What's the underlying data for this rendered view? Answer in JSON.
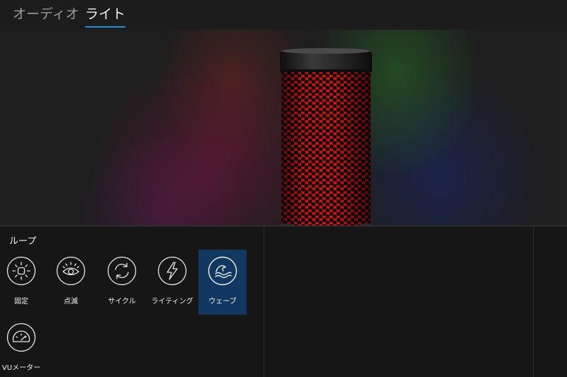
{
  "tabs": [
    {
      "label": "オーディオ",
      "active": false
    },
    {
      "label": "ライト",
      "active": true
    }
  ],
  "accent_color": "#1f8fd6",
  "selected_bg_color": "#123861",
  "led_color": "#e01010",
  "panel": {
    "section_title": "ループ",
    "effects": [
      {
        "label": "固定",
        "icon": "sun-icon",
        "selected": false
      },
      {
        "label": "点滅",
        "icon": "eye-icon",
        "selected": false
      },
      {
        "label": "サイクル",
        "icon": "cycle-icon",
        "selected": false
      },
      {
        "label": "ライティング",
        "icon": "lightning-icon",
        "selected": false
      },
      {
        "label": "ウェーブ",
        "icon": "wave-icon",
        "selected": true
      },
      {
        "label": "VUメーター",
        "icon": "gauge-icon",
        "selected": false
      }
    ]
  }
}
